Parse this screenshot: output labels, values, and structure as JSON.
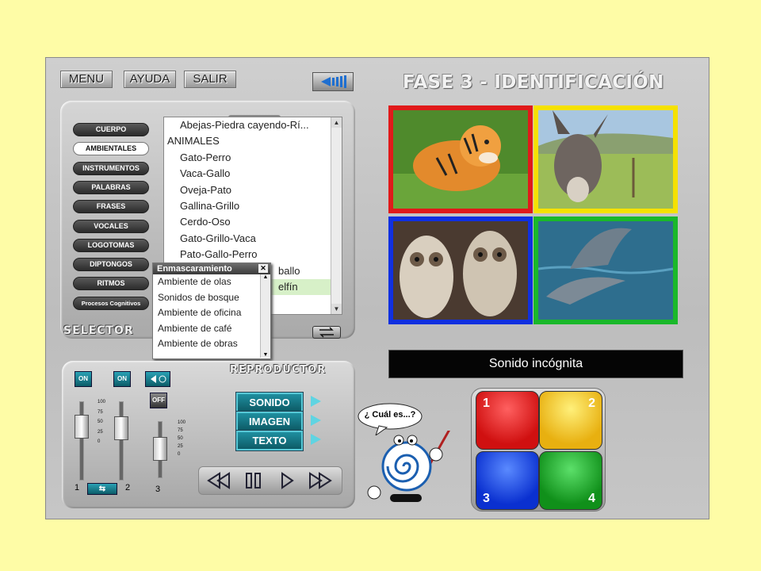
{
  "menu": {
    "menu_label": "MENU",
    "help_label": "AYUDA",
    "exit_label": "SALIR",
    "volume_icon": "speaker-icon"
  },
  "title": "FASE 3 - IDENTIFICACIÓN",
  "selector": {
    "label": "SELECTOR",
    "categories": [
      "CUERPO",
      "AMBIENTALES",
      "INSTRUMENTOS",
      "PALABRAS",
      "FRASES",
      "VOCALES",
      "LOGOTOMAS",
      "DIPTONGOS",
      "RITMOS",
      "Procesos Cognitivos"
    ],
    "active_category": "AMBIENTALES",
    "list_items": [
      "Abejas-Piedra cayendo-Rí...",
      "ANIMALES",
      "Gato-Perro",
      "Vaca-Gallo",
      "Oveja-Pato",
      "Gallina-Grillo",
      "Cerdo-Oso",
      "Gato-Grillo-Vaca",
      "Pato-Gallo-Perro",
      "ballo",
      "elfín"
    ]
  },
  "masking_popup": {
    "title": "Enmascaramiento",
    "close_label": "✕",
    "items": [
      "Ambiente de olas",
      "Sonidos de bosque",
      "Ambiente de oficina",
      "Ambiente de café",
      "Ambiente de obras"
    ]
  },
  "images": {
    "colors": {
      "red": "#e01a1a",
      "yellow": "#f5e100",
      "blue": "#1030e0",
      "green": "#1ab82a"
    }
  },
  "unknown_sound_label": "Sonido incógnita",
  "player": {
    "label": "REPRODUCTOR",
    "on1": "ON",
    "on2": "ON",
    "off": "OFF",
    "buttons": [
      "SONIDO",
      "IMAGEN",
      "TEXTO"
    ],
    "fader_labels": {
      "left": "1",
      "right": "2",
      "third": "3"
    },
    "scale_ticks": [
      "100",
      "75",
      "50",
      "25",
      "0"
    ],
    "scale_ticks_small": [
      "100",
      "75",
      "50",
      "25",
      "0"
    ]
  },
  "mascot": {
    "speech": "¿ Cuál es...?"
  },
  "answer_pad": {
    "numbers": [
      "1",
      "2",
      "3",
      "4"
    ]
  }
}
